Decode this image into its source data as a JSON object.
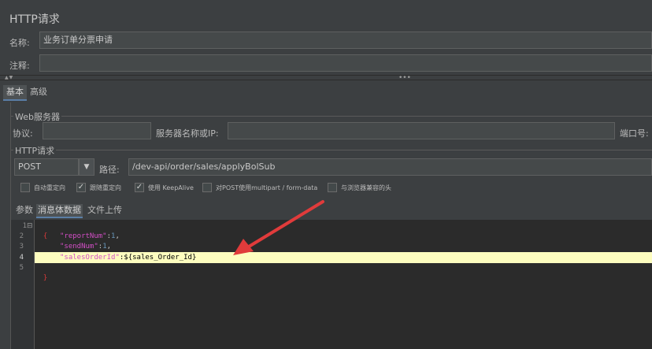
{
  "window": {
    "title": "HTTP请求"
  },
  "form": {
    "name_label": "名称:",
    "name_value": "业务订单分票申请",
    "comment_label": "注释:",
    "comment_value": ""
  },
  "splitter": {
    "arrows": "▲▼",
    "dots": "•••"
  },
  "top_tabs": [
    {
      "label": "基本",
      "active": true
    },
    {
      "label": "高级",
      "active": false
    }
  ],
  "web_server": {
    "section_title": "Web服务器",
    "protocol_label": "协议:",
    "protocol_value": "",
    "server_label": "服务器名称或IP:",
    "server_value": "",
    "port_label": "端口号:"
  },
  "http_request": {
    "section_title": "HTTP请求",
    "method": "POST",
    "path_label": "路径:",
    "path_value": "/dev-api/order/sales/applyBolSub"
  },
  "checkboxes": [
    {
      "label": "自动重定向",
      "checked": false
    },
    {
      "label": "跟随重定向",
      "checked": true
    },
    {
      "label": "使用 KeepAlive",
      "checked": true
    },
    {
      "label": "对POST使用multipart / form-data",
      "checked": false
    },
    {
      "label": "与浏览器兼容的头",
      "checked": false
    }
  ],
  "sub_tabs": [
    {
      "label": "参数",
      "active": false
    },
    {
      "label": "消息体数据",
      "active": true
    },
    {
      "label": "文件上传",
      "active": false
    }
  ],
  "editor": {
    "line_numbers": [
      "1",
      "2",
      "3",
      "4",
      "5"
    ],
    "fold_marker": "⊟",
    "lines": {
      "l1_brace": "{",
      "l2_key": "\"reportNum\"",
      "l2_colon": ":",
      "l2_value": "1",
      "l2_comma": ",",
      "l3_key": "\"sendNum\"",
      "l3_colon": ":",
      "l3_value": "1",
      "l3_comma": ",",
      "l4_key": "\"salesOrderId\"",
      "l4_rest": ":${sales_Order_Id}",
      "l5_brace": "}"
    },
    "highlight_line": 4
  },
  "colors": {
    "background": "#3c3f41",
    "editor_bg": "#2b2b2b",
    "highlight": "#fdfdbf",
    "annotation_arrow": "#e03b3b"
  }
}
